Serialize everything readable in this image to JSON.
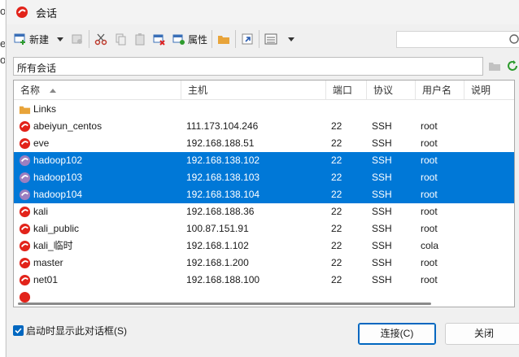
{
  "window": {
    "title": "会话"
  },
  "toolbar": {
    "new_label": "新建",
    "properties_label": "属性"
  },
  "search": {
    "placeholder": ""
  },
  "path": {
    "current": "所有会话"
  },
  "columns": [
    "名称",
    "主机",
    "端口",
    "协议",
    "用户名",
    "说明"
  ],
  "sessions": [
    {
      "name": "Links",
      "host": "",
      "port": "",
      "protocol": "",
      "user": "",
      "icon": "folder-icon",
      "selected": false
    },
    {
      "name": "abeiyun_centos",
      "host": "111.173.104.246",
      "port": "22",
      "protocol": "SSH",
      "user": "root",
      "icon": "session-icon",
      "selected": false
    },
    {
      "name": "eve",
      "host": "192.168.188.51",
      "port": "22",
      "protocol": "SSH",
      "user": "root",
      "icon": "session-icon",
      "selected": false
    },
    {
      "name": "hadoop102",
      "host": "192.168.138.102",
      "port": "22",
      "protocol": "SSH",
      "user": "root",
      "icon": "session-icon",
      "selected": true
    },
    {
      "name": "hadoop103",
      "host": "192.168.138.103",
      "port": "22",
      "protocol": "SSH",
      "user": "root",
      "icon": "session-icon",
      "selected": true
    },
    {
      "name": "hadoop104",
      "host": "192.168.138.104",
      "port": "22",
      "protocol": "SSH",
      "user": "root",
      "icon": "session-icon",
      "selected": true
    },
    {
      "name": "kali",
      "host": "192.168.188.36",
      "port": "22",
      "protocol": "SSH",
      "user": "root",
      "icon": "session-icon",
      "selected": false
    },
    {
      "name": "kali_public",
      "host": "100.87.151.91",
      "port": "22",
      "protocol": "SSH",
      "user": "root",
      "icon": "session-icon",
      "selected": false
    },
    {
      "name": "kali_临时",
      "host": "192.168.1.102",
      "port": "22",
      "protocol": "SSH",
      "user": "cola",
      "icon": "session-icon",
      "selected": false
    },
    {
      "name": "master",
      "host": "192.168.1.200",
      "port": "22",
      "protocol": "SSH",
      "user": "root",
      "icon": "session-icon",
      "selected": false
    },
    {
      "name": "net01",
      "host": "192.168.188.100",
      "port": "22",
      "protocol": "SSH",
      "user": "root",
      "icon": "session-icon",
      "selected": false
    }
  ],
  "footer": {
    "startup_checkbox_label": "启动时显示此对话框(S)",
    "startup_checked": true,
    "connect_label": "连接(C)",
    "close_label": "关闭"
  },
  "colors": {
    "selection": "#0078d7",
    "accent": "#0067c0",
    "session_icon": "#e2231a"
  }
}
